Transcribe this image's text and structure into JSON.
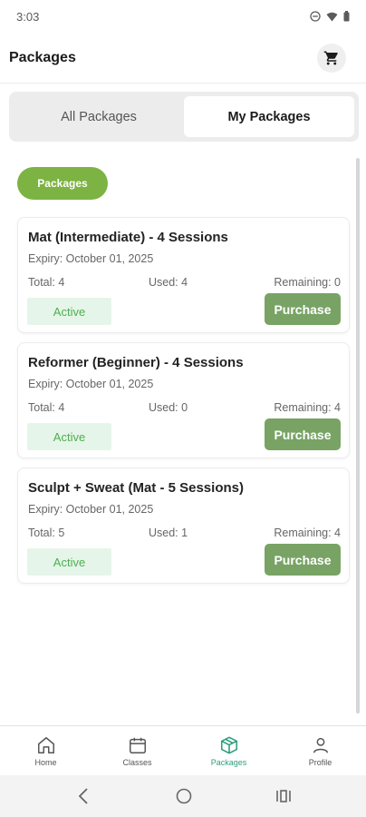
{
  "status_bar": {
    "time": "3:03"
  },
  "header": {
    "title": "Packages",
    "cart_icon": "cart-icon"
  },
  "tabs": [
    {
      "label": "All Packages",
      "active": false
    },
    {
      "label": "My Packages",
      "active": true
    }
  ],
  "filter": {
    "label": "Packages",
    "color": "#7cb342"
  },
  "packages": [
    {
      "title": "Mat (Intermediate) - 4 Sessions",
      "expiry": "Expiry: October 01, 2025",
      "total": "Total: 4",
      "used": "Used: 4",
      "remaining": "Remaining: 0",
      "status": "Active",
      "action": "Purchase"
    },
    {
      "title": "Reformer (Beginner) - 4 Sessions",
      "expiry": "Expiry: October 01, 2025",
      "total": "Total: 4",
      "used": "Used: 0",
      "remaining": "Remaining: 4",
      "status": "Active",
      "action": "Purchase"
    },
    {
      "title": "Sculpt + Sweat (Mat - 5 Sessions)",
      "expiry": "Expiry: October 01, 2025",
      "total": "Total: 5",
      "used": "Used: 1",
      "remaining": "Remaining: 4",
      "status": "Active",
      "action": "Purchase"
    }
  ],
  "bottom_nav": [
    {
      "label": "Home",
      "icon": "home-icon",
      "active": false
    },
    {
      "label": "Classes",
      "icon": "calendar-icon",
      "active": false
    },
    {
      "label": "Packages",
      "icon": "package-icon",
      "active": true
    },
    {
      "label": "Profile",
      "icon": "person-icon",
      "active": false
    }
  ],
  "colors": {
    "accent_green": "#7cb342",
    "purchase_green": "#78a365",
    "active_nav": "#2e9d7c",
    "badge_bg": "#e6f5e9"
  }
}
